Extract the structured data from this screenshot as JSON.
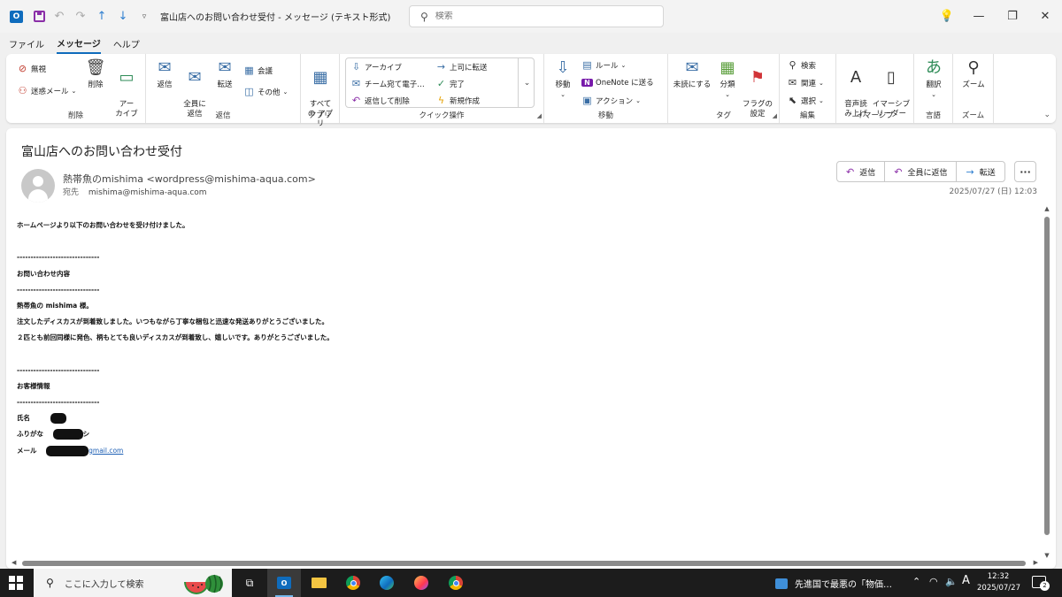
{
  "titlebar": {
    "title": "富山店へのお問い合わせ受付  -  メッセージ (テキスト形式)",
    "search_placeholder": "検索"
  },
  "menu": [
    "ファイル",
    "メッセージ",
    "ヘルプ"
  ],
  "ribbon": {
    "delete_group": {
      "label": "削除",
      "ignore": "無視",
      "junk": "迷惑メール",
      "delete": "削除",
      "archive": "アー\nカイブ"
    },
    "reply_group": {
      "label": "返信",
      "reply": "返信",
      "reply_all": "全員に\n返信",
      "forward": "転送",
      "meeting": "会議",
      "more": "その他"
    },
    "apps_group": {
      "label": "アプリ",
      "all_apps": "すべて\nの アプリ"
    },
    "quick_steps": {
      "label": "クイック操作",
      "items": [
        "アーカイブ",
        "上司に転送",
        "チーム宛て電子…",
        "完了",
        "返信して削除",
        "新規作成"
      ]
    },
    "move_group": {
      "label": "移動",
      "move": "移動",
      "rules": "ルール",
      "onenote": "OneNote に送る",
      "actions": "アクション"
    },
    "tags_group": {
      "label": "タグ",
      "unread": "未読にする",
      "categorize": "分類",
      "flag": "フラグの\n設定"
    },
    "edit_group": {
      "label": "編集",
      "find": "検索",
      "related": "関連",
      "select": "選択"
    },
    "immersive_group": {
      "label": "イマーシブ",
      "read_aloud": "音声読\nみ上げ",
      "reader": "イマーシブ\nリーダー"
    },
    "language_group": {
      "label": "言語",
      "translate": "翻訳"
    },
    "zoom_group": {
      "label": "ズーム",
      "zoom": "ズーム"
    }
  },
  "message": {
    "subject": "富山店へのお問い合わせ受付",
    "sender": "熱帯魚のmishima <wordpress@mishima-aqua.com>",
    "to_label": "宛先",
    "to": "mishima@mishima-aqua.com",
    "actions": [
      "返信",
      "全員に返信",
      "転送"
    ],
    "date": "2025/07/27 (日) 12:03",
    "body": {
      "intro": "ホームページより以下のお問い合わせを受け付けました。",
      "divider": "------------------------------",
      "inquiry_heading": "お問い合わせ内容",
      "line1": "熱帯魚の mishima 様。",
      "line2": "注文したディスカスが到着致しました。いつもながら丁寧な梱包と迅速な発送ありがとうございました。",
      "line3": "２匹とも前回同様に発色、柄もとても良いディスカスが到着致し、嬉しいです。ありがとうございました。",
      "customer_heading": "お客様情報",
      "name_label": "氏名",
      "kana_label": "ふりがな",
      "kana_suffix": "シ",
      "mail_label": "メール",
      "mail_suffix": "gmail.com"
    }
  },
  "taskbar": {
    "search_placeholder": "ここに入力して検索",
    "news": "先進国で最悪の「物価…",
    "ime": "A",
    "time": "12:32",
    "date": "2025/07/27",
    "notifications": "2"
  }
}
